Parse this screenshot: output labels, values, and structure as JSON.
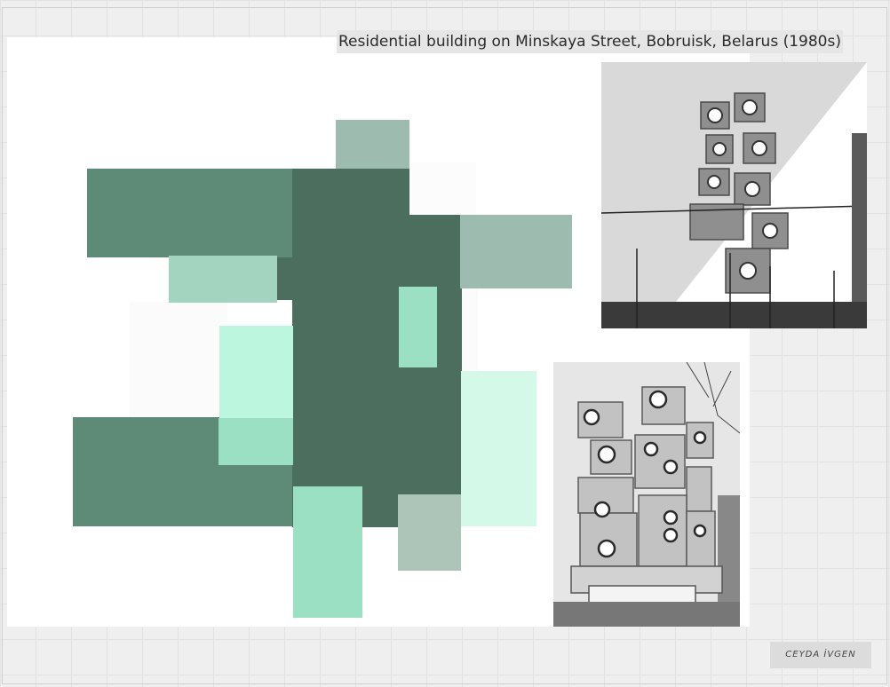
{
  "caption": {
    "title": "Residential building on Minskaya Street, Bobruisk, Belarus (1980s)",
    "author": "CEYDA İVGEN"
  },
  "colors": {
    "dark_green": "#4b6e5e",
    "medium_green": "#5e8b77",
    "sage": "#9dbbae",
    "pale_sage": "#adc4b9",
    "mint": "#a3d4bf",
    "bright_mint": "#9be0c3",
    "light_mint": "#bdf6df",
    "pale_mint": "#d4f9e9"
  },
  "photos": [
    {
      "name": "photo-building-aerial",
      "description_icon": "building-photo-icon"
    },
    {
      "name": "photo-building-street",
      "description_icon": "building-photo-icon"
    }
  ]
}
